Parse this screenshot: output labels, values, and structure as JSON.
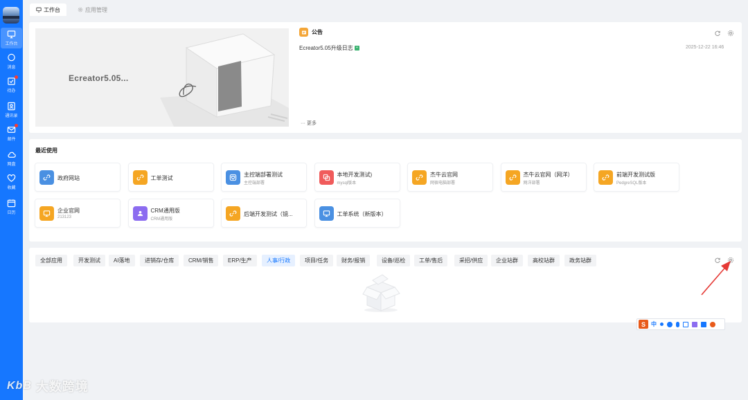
{
  "sidebar": {
    "items": [
      {
        "label": "工作台",
        "icon": "monitor-icon",
        "active": true
      },
      {
        "label": "消息",
        "icon": "chat-icon"
      },
      {
        "label": "待办",
        "icon": "todo-icon",
        "badge": true
      },
      {
        "label": "通讯录",
        "icon": "contacts-icon"
      },
      {
        "label": "邮件",
        "icon": "mail-icon",
        "badge": true
      },
      {
        "label": "网盘",
        "icon": "cloud-icon"
      },
      {
        "label": "收藏",
        "icon": "heart-icon"
      },
      {
        "label": "日历",
        "icon": "calendar-icon"
      }
    ]
  },
  "tabs": [
    {
      "label": "工作台",
      "active": true
    },
    {
      "label": "应用管理",
      "active": false
    }
  ],
  "banner": {
    "text": "Ecreator5.05..."
  },
  "notice": {
    "title": "公告",
    "item_title": "Ecreator5.05升级日志",
    "item_time": "2025-12-22 16:46",
    "more": "··· 更多"
  },
  "recent": {
    "title": "最近使用",
    "apps": [
      {
        "name": "政府网站",
        "sub": "",
        "color": "#4a90e2",
        "icon": "link-icon"
      },
      {
        "name": "工单测试",
        "sub": "",
        "color": "#f5a623",
        "icon": "link-icon"
      },
      {
        "name": "主控端部署测试",
        "sub": "主控端部署",
        "color": "#4a90e2",
        "icon": "heart-outline-icon"
      },
      {
        "name": "本地开发测试)",
        "sub": "mysql版本",
        "color": "#f05b5b",
        "icon": "copy-icon"
      },
      {
        "name": "杰牛云官网",
        "sub": "网宿电脑部署",
        "color": "#f5a623",
        "icon": "link-icon"
      },
      {
        "name": "杰牛云官网（网洋）",
        "sub": "网洋部署",
        "color": "#f5a623",
        "icon": "link-icon"
      },
      {
        "name": "前端开发测试版",
        "sub": "PedgreSQL版本",
        "color": "#f5a623",
        "icon": "link-icon"
      },
      {
        "name": "企业官网",
        "sub": "213123",
        "color": "#f5a623",
        "icon": "monitor-icon"
      },
      {
        "name": "CRM通用版",
        "sub": "CRM通用版",
        "color": "#8c6cf0",
        "icon": "users-icon"
      },
      {
        "name": "后端开发测试（镜...",
        "sub": "",
        "color": "#f5a623",
        "icon": "link-icon"
      },
      {
        "name": "工单系统（新版本）",
        "sub": "",
        "color": "#4a90e2",
        "icon": "monitor-icon"
      }
    ]
  },
  "filters": {
    "chips": [
      "全部应用",
      "开发测试",
      "AI落地",
      "进销存/仓库",
      "CRM/销售",
      "ERP/生产",
      "人事/行政",
      "项目/任务",
      "财务/报销",
      "设备/巡检",
      "工单/售后",
      "采招/供应",
      "企业站群",
      "高校站群",
      "政务站群"
    ],
    "active_index": 6
  },
  "ime": {
    "logo": "S",
    "mode": "中"
  },
  "watermark": {
    "logo": "KbB",
    "text": "大数跨境"
  },
  "colors": {
    "primary": "#1677ff",
    "accent_orange": "#f5a623",
    "annotation_red": "#e53935"
  }
}
